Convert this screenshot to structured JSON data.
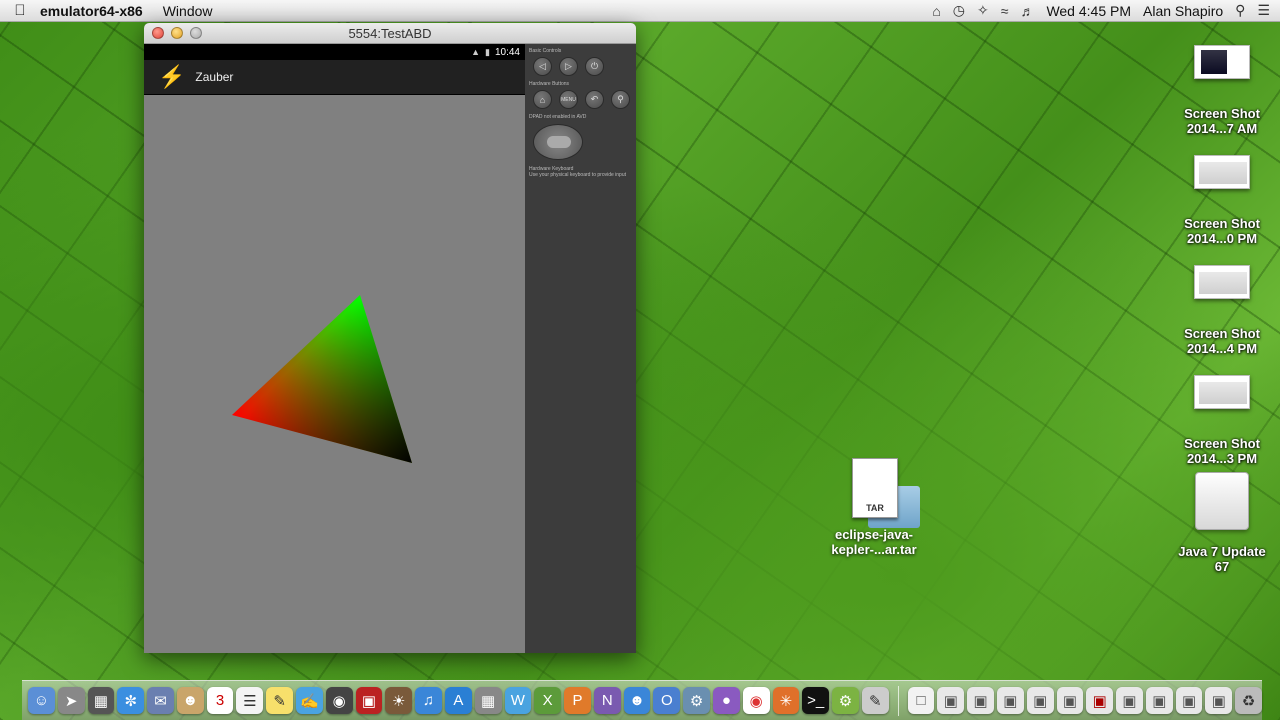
{
  "menubar": {
    "app_name": "emulator64-x86",
    "menus": [
      "Window"
    ],
    "clock": "Wed 4:45 PM",
    "user": "Alan Shapiro"
  },
  "window": {
    "title": "5554:TestABD"
  },
  "device": {
    "status_time": "10:44",
    "app_title": "Zauber",
    "app_icon": "lightning-bolt-icon",
    "accent_color": "#e23cf0",
    "triangle_colors": [
      "#ff0000",
      "#00ff00",
      "#000000"
    ]
  },
  "controls": {
    "basic_label": "Basic Controls",
    "hardware_label": "Hardware Buttons",
    "dpad_label": "DPAD not enabled in AVD",
    "keyboard_label": "Hardware Keyboard",
    "keyboard_hint": "Use your physical keyboard to provide input",
    "menu_label": "MENU"
  },
  "desktop": {
    "screenshots": [
      {
        "line1": "Screen Shot",
        "line2": "2014...7 AM"
      },
      {
        "line1": "Screen Shot",
        "line2": "2014...0 PM"
      },
      {
        "line1": "Screen Shot",
        "line2": "2014...4 PM"
      },
      {
        "line1": "Screen Shot",
        "line2": "2014...3 PM"
      }
    ],
    "tar": {
      "badge": "TAR",
      "line1": "eclipse-java-",
      "line2": "kepler-...ar.tar"
    },
    "drive": {
      "line1": "Java 7 Update",
      "line2": "67"
    }
  }
}
